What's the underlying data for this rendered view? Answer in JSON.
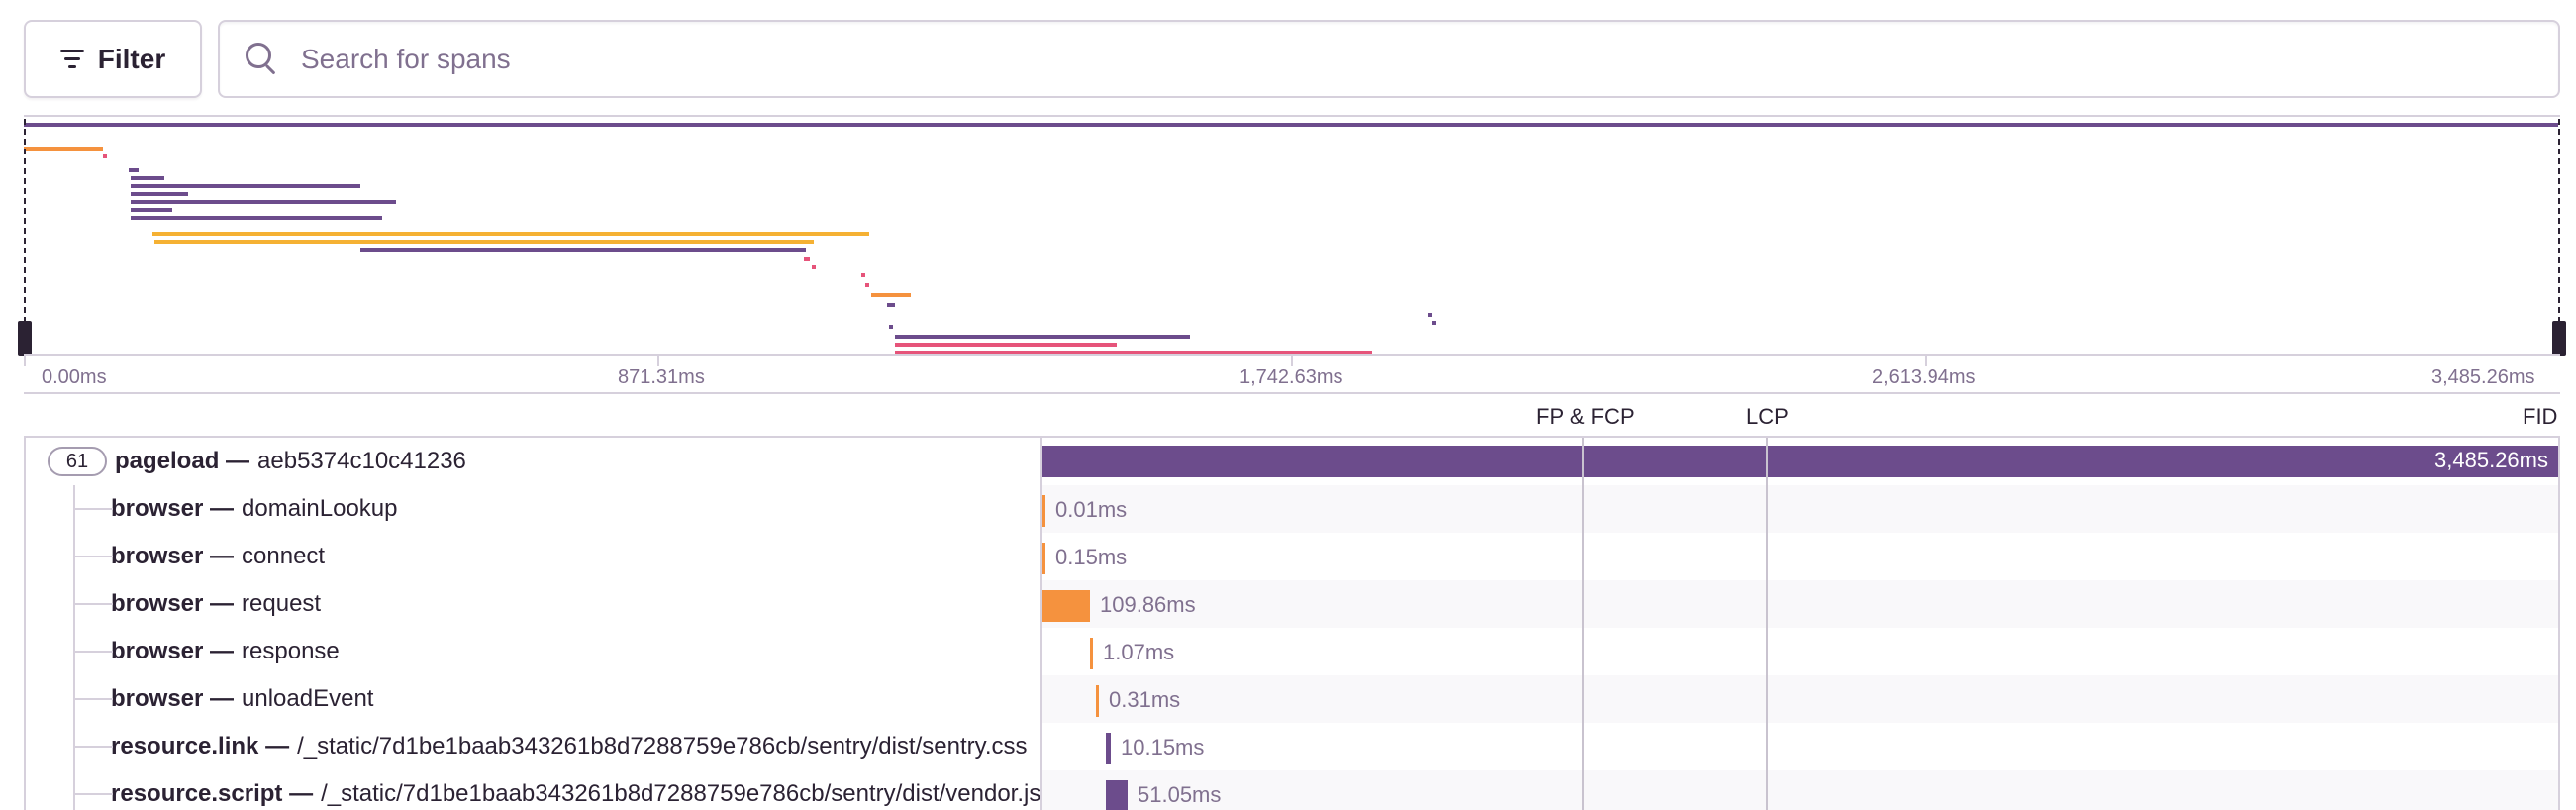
{
  "toolbar": {
    "filter_label": "Filter",
    "filter_icon": "filter-icon",
    "search_icon": "search-icon",
    "search_placeholder": "Search for spans",
    "search_value": ""
  },
  "colors": {
    "purple": "#6c4c8c",
    "orange": "#f5923e",
    "yellow": "#f5b133",
    "pink": "#e6547a",
    "border": "#d6d0dc",
    "muted": "#80708f"
  },
  "axis_ticks": [
    "0.00ms",
    "871.31ms",
    "1,742.63ms",
    "2,613.94ms",
    "3,485.26ms"
  ],
  "vitals": [
    "FP & FCP",
    "LCP",
    "FID"
  ],
  "root": {
    "count": "61",
    "op": "pageload —",
    "description": "aeb5374c10c41236",
    "duration": "3,485.26ms"
  },
  "spans": [
    {
      "op": "browser —",
      "description": "domainLookup",
      "duration": "0.01ms"
    },
    {
      "op": "browser —",
      "description": "connect",
      "duration": "0.15ms"
    },
    {
      "op": "browser —",
      "description": "request",
      "duration": "109.86ms"
    },
    {
      "op": "browser —",
      "description": "response",
      "duration": "1.07ms"
    },
    {
      "op": "browser —",
      "description": "unloadEvent",
      "duration": "0.31ms"
    },
    {
      "op": "resource.link —",
      "description": "/_static/7d1be1baab343261b8d7288759e786cb/sentry/dist/sentry.css",
      "duration": "10.15ms"
    },
    {
      "op": "resource.script —",
      "description": "/_static/7d1be1baab343261b8d7288759e786cb/sentry/dist/vendor.js",
      "duration": "51.05ms"
    }
  ]
}
